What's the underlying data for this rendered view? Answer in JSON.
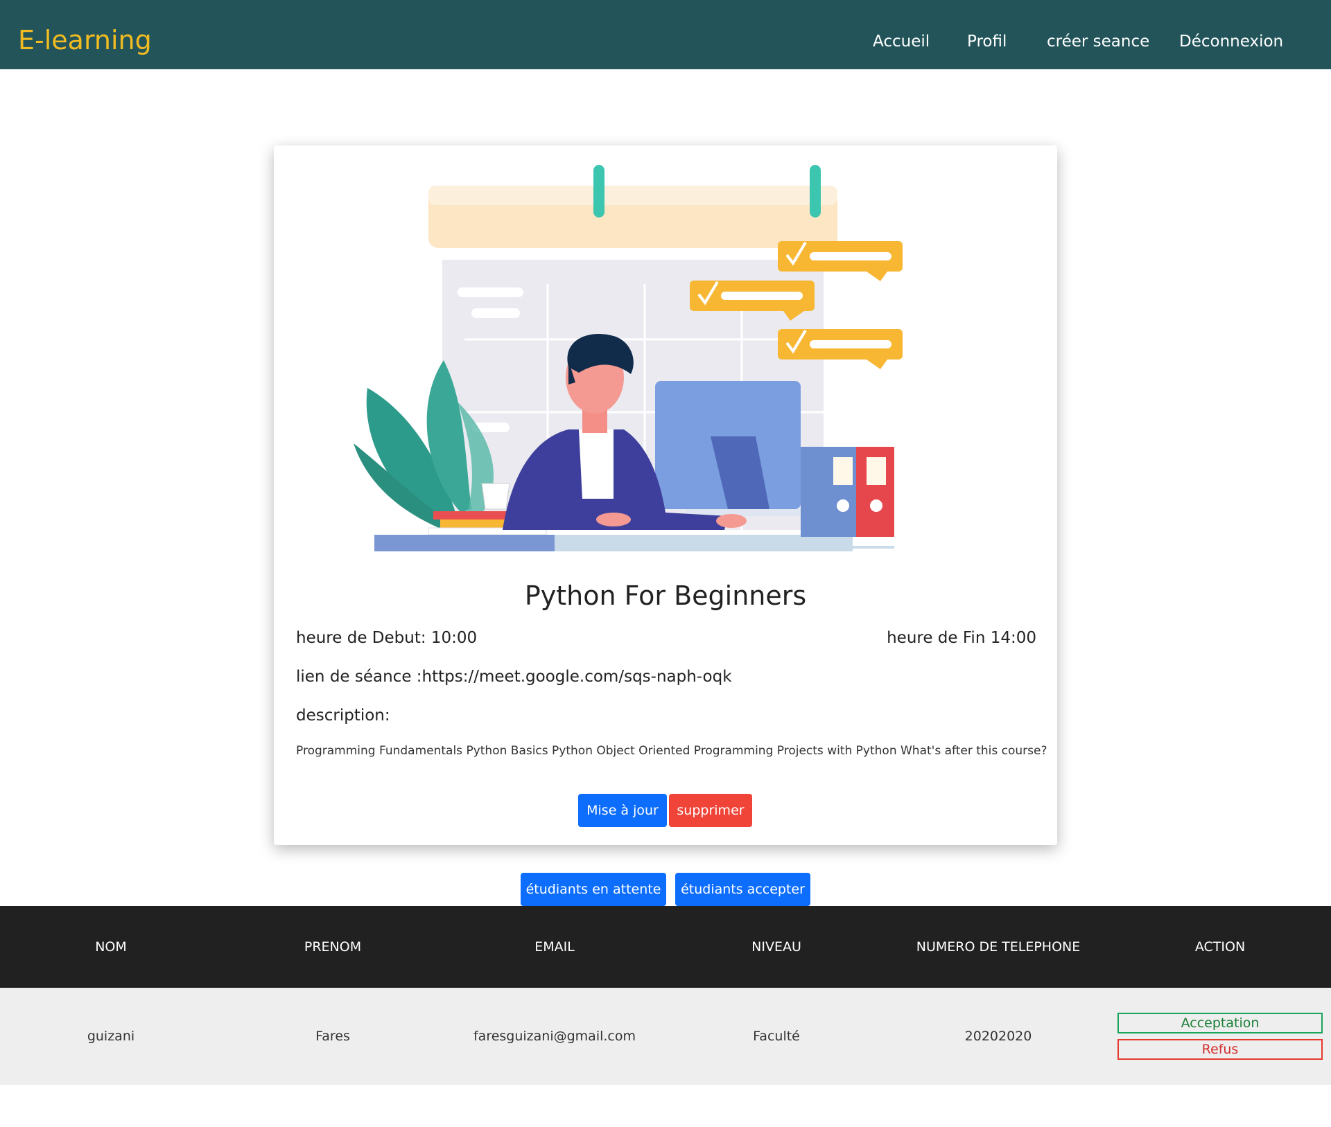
{
  "navbar": {
    "brand": "E-learning",
    "links": [
      "Accueil",
      "Profil",
      "créer seance",
      "Déconnexion"
    ]
  },
  "session": {
    "title": "Python For Beginners",
    "start_time": "heure de Debut: 10:00",
    "end_time": "heure de Fin 14:00",
    "link": "lien de séance :https://meet.google.com/sqs-naph-oqk",
    "description_label": "description:",
    "description": "Programming Fundamentals Python Basics Python Object Oriented Programming Projects with Python What's after this course?",
    "update_label": "Mise à jour",
    "delete_label": "supprimer"
  },
  "filters": {
    "waiting_label": "étudiants en attente",
    "accepted_label": "étudiants accepter"
  },
  "table": {
    "headers": [
      "NOM",
      "PRENOM",
      "EMAIL",
      "NIVEAU",
      "NUMERO DE TELEPHONE",
      "ACTION"
    ],
    "rows": [
      {
        "nom": "guizani",
        "prenom": "Fares",
        "email": "faresguizani@gmail.com",
        "niveau": "Faculté",
        "telephone": "20202020",
        "accept_label": "Acceptation",
        "refuse_label": "Refus"
      }
    ]
  },
  "colors": {
    "navbar_bg": "#22545a",
    "brand": "#f2bb22",
    "primary": "#0d6efd",
    "danger": "#f04438",
    "table_header_bg": "#212121",
    "accept": "#1aa35a",
    "refuse": "#e5392e"
  }
}
